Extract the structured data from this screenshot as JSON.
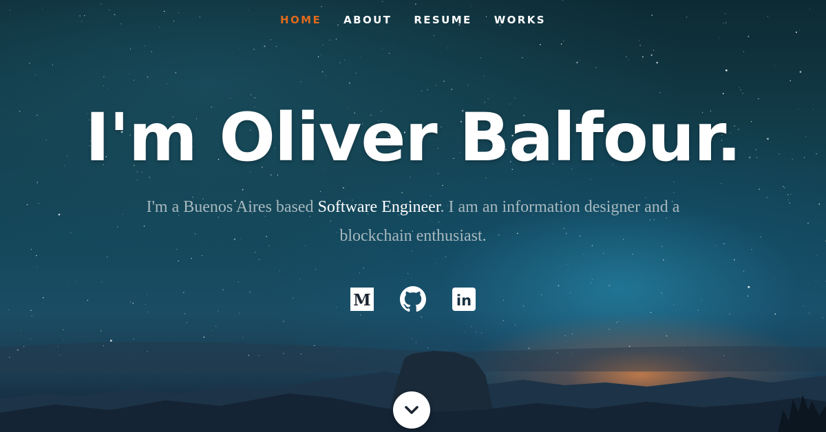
{
  "nav": {
    "items": [
      {
        "label": "HOME",
        "active": true
      },
      {
        "label": "ABOUT",
        "active": false
      },
      {
        "label": "RESUME",
        "active": false
      },
      {
        "label": "WORKS",
        "active": false
      }
    ],
    "active_color": "#e06a1c"
  },
  "hero": {
    "headline": "I'm Oliver Balfour.",
    "tagline": {
      "before": "I'm a Buenos Aires based ",
      "highlight": "Software Engineer",
      "after": ". I am an information designer and a blockchain enthusiast."
    }
  },
  "social": {
    "icons": [
      "medium-icon",
      "github-icon",
      "linkedin-icon"
    ],
    "medium_letter": "M",
    "linkedin_letters": "in"
  },
  "scroll": {
    "icon": "chevron-down-icon"
  }
}
